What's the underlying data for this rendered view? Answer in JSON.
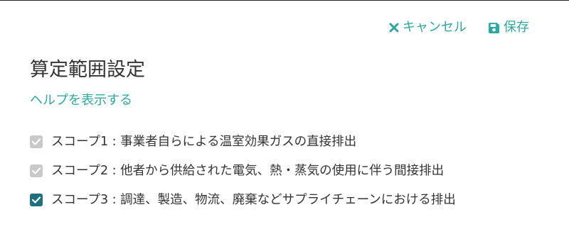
{
  "toolbar": {
    "cancel_label": "キャンセル",
    "save_label": "保存",
    "accent_color": "#2aa9a3"
  },
  "header": {
    "title": "算定範囲設定",
    "help_link": "ヘルプを表示する"
  },
  "scopes": [
    {
      "label": "スコープ1 : 事業者自らによる温室効果ガスの直接排出",
      "checked": true,
      "disabled": true
    },
    {
      "label": "スコープ2 : 他者から供給された電気、熱・蒸気の使用に伴う間接排出",
      "checked": true,
      "disabled": true
    },
    {
      "label": "スコープ3 : 調達、製造、物流、廃棄などサプライチェーンにおける排出",
      "checked": true,
      "disabled": false
    }
  ]
}
